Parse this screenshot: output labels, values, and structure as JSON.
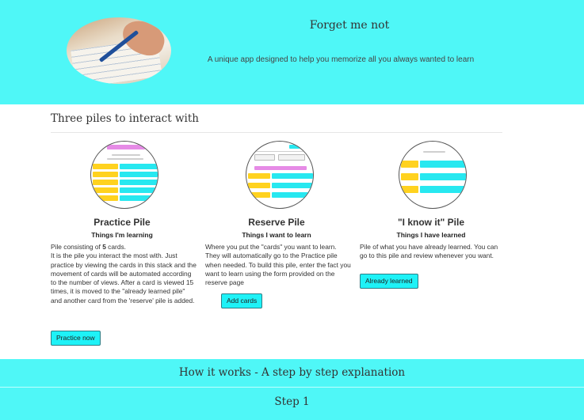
{
  "hero": {
    "title": "Forget me not",
    "tagline": "A unique app designed to help you memorize all you always wanted to learn"
  },
  "piles_section": {
    "title": "Three piles to interact with"
  },
  "piles": [
    {
      "title": "Practice Pile",
      "subtitle": "Things I'm learning",
      "desc_prefix": "Pile consisting of ",
      "card_count": "5",
      "desc_suffix": " cards.",
      "description": "It is the pile you interact the most with. Just practice by viewing the cards in this stack and the movement of cards will be automated according to the number of views. After a card is viewed 15 times, it is moved to the \"already learned pile\" and another card from the 'reserve' pile is added.",
      "button_label": "Practice now"
    },
    {
      "title": "Reserve Pile",
      "subtitle": "Things I want to learn",
      "description": "Where you put the \"cards\" you want to learn. They will automatically go to the Practice pile when needed. To build this pile, enter the fact you want to learn using the form provided on the reserve page",
      "button_label": "Add cards"
    },
    {
      "title": "\"I know it\" Pile",
      "subtitle": "Things I have learned",
      "description": "Pile of what you have already learned. You can go to this pile and review whenever you want.",
      "button_label": "Already learned"
    }
  ],
  "how_it_works": {
    "title": "How it works - A step by step explanation"
  },
  "step": {
    "title": "Step 1"
  },
  "colors": {
    "band": "#4ff7f7",
    "button": "#1ef2f7",
    "card_yellow": "#ffd21f",
    "card_cyan": "#27e8f0",
    "card_pink": "#e68be6"
  }
}
